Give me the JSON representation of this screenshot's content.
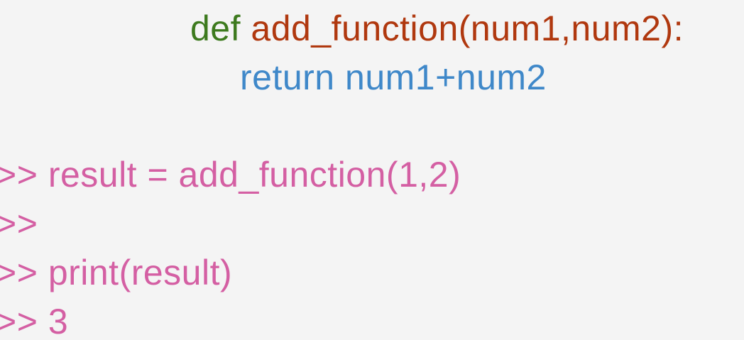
{
  "code_block": {
    "def_keyword": "def",
    "signature": "add_function(num1,num2):",
    "return_statement": "return num1+num2"
  },
  "repl": {
    "lines": [
      {
        "prompt": ">>",
        "text": "result = add_function(1,2)"
      },
      {
        "prompt": ">>",
        "text": ""
      },
      {
        "prompt": ">>",
        "text": "print(result)"
      },
      {
        "prompt": ">>",
        "text": "3"
      }
    ]
  },
  "colors": {
    "background": "#f4f4f4",
    "def_keyword": "#3d7a1e",
    "function_signature": "#b0380f",
    "return_statement": "#3f88c9",
    "repl_text": "#d45fa3"
  }
}
